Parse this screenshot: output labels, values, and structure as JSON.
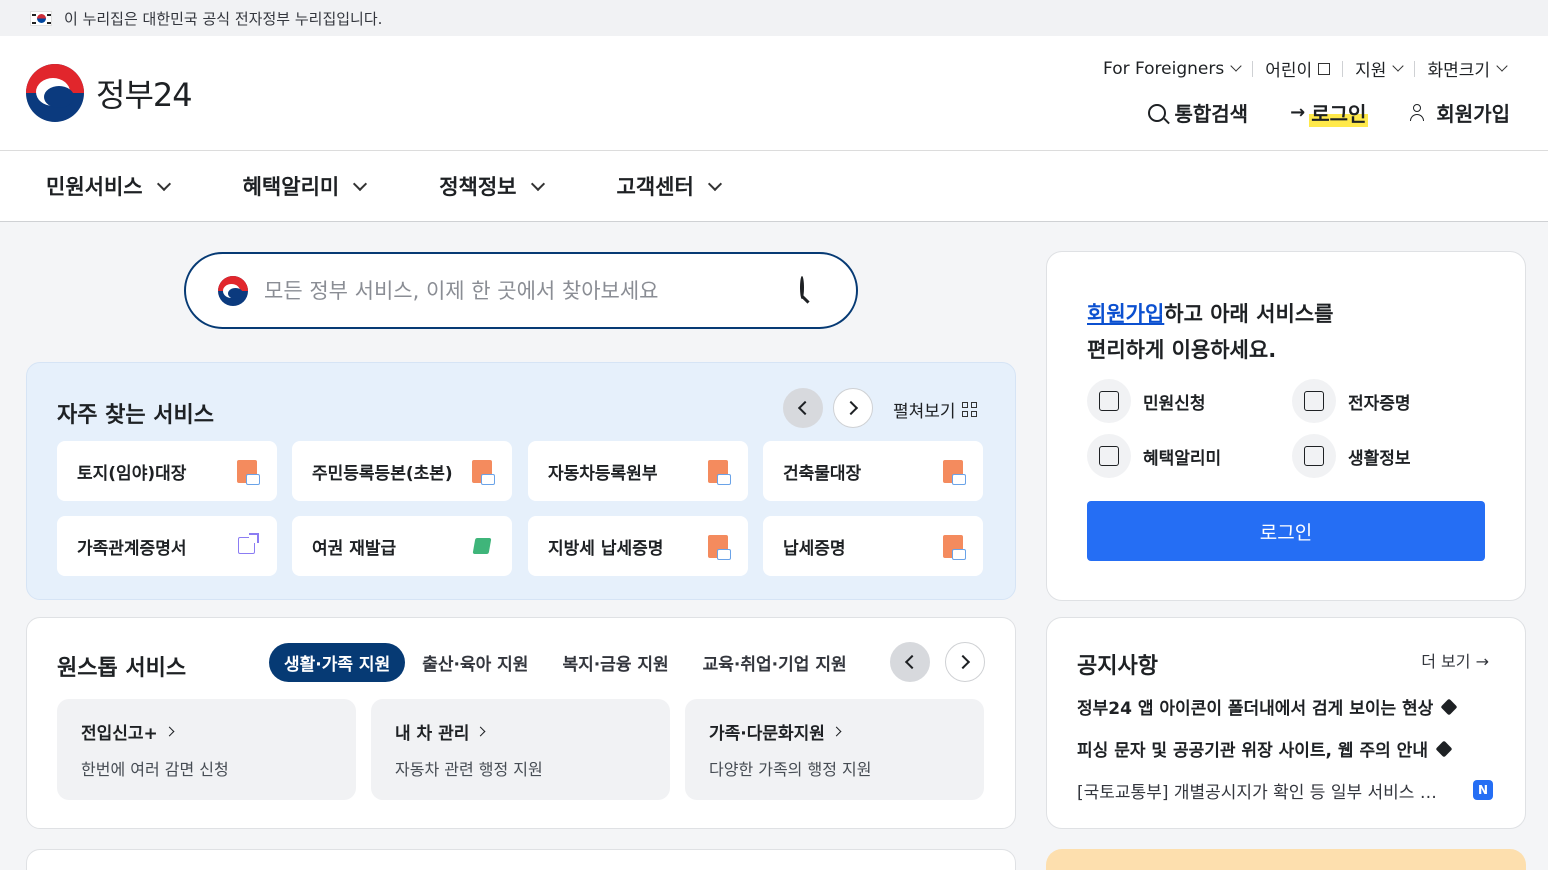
{
  "gov_banner": {
    "text": "이 누리집은 대한민국 공식 전자정부 누리집입니다."
  },
  "logo": {
    "text": "정부24",
    "accent_color": "#e1262c"
  },
  "utility_nav": {
    "foreigners": "For Foreigners",
    "kids": "어린이",
    "support": "지원",
    "display_size": "화면크기"
  },
  "header_actions": {
    "search": "통합검색",
    "login": "로그인",
    "signup": "회원가입"
  },
  "gnb": {
    "items": [
      "민원서비스",
      "혜택알리미",
      "정책정보",
      "고객센터"
    ]
  },
  "search": {
    "placeholder": "모든 정부 서비스, 이제 한 곳에서 찾아보세요"
  },
  "frequent": {
    "title": "자주 찾는 서비스",
    "expand_label": "펼쳐보기",
    "cards": [
      {
        "label": "토지(임야)대장",
        "icon": "pdf-icon"
      },
      {
        "label": "주민등록등본(초본)",
        "icon": "pdf-icon"
      },
      {
        "label": "자동차등록원부",
        "icon": "pdf-icon"
      },
      {
        "label": "건축물대장",
        "icon": "pdf-icon"
      },
      {
        "label": "가족관계증명서",
        "icon": "external-link-icon"
      },
      {
        "label": "여권 재발급",
        "icon": "pen-icon"
      },
      {
        "label": "지방세 납세증명",
        "icon": "pdf-icon"
      },
      {
        "label": "납세증명",
        "icon": "pdf-icon"
      }
    ]
  },
  "onestop": {
    "title": "원스톱 서비스",
    "tabs": [
      "생활·가족 지원",
      "출산·육아 지원",
      "복지·금융 지원",
      "교육·취업·기업 지원"
    ],
    "cards": [
      {
        "title": "전입신고+",
        "desc": "한번에 여러 감면 신청"
      },
      {
        "title": "내 차 관리",
        "desc": "자동차 관련 행정 지원"
      },
      {
        "title": "가족·다문화지원",
        "desc": "다양한 가족의 행정 지원"
      }
    ]
  },
  "login_panel": {
    "signup_link": "회원가입",
    "msg_rest": "하고 아래 서비스를",
    "msg_line2": "편리하게 이용하세요.",
    "services": [
      "민원신청",
      "전자증명",
      "혜택알리미",
      "생활정보"
    ],
    "button": "로그인",
    "button_color": "#256ef4"
  },
  "notice": {
    "title": "공지사항",
    "more": "더 보기",
    "items": [
      "정부24 앱 아이콘이 폴더내에서 검게 보이는 현상",
      "피싱 문자 및 공공기관 위장 사이트, 웹 주의 안내",
      "[국토교통부] 개별공시지가 확인 등 일부 서비스 일시 중단 안내"
    ],
    "new_badge": "N"
  }
}
